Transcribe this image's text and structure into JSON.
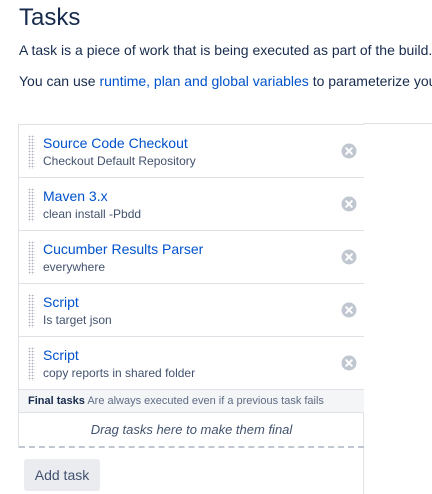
{
  "page": {
    "title": "Tasks",
    "description": "A task is a piece of work that is being executed as part of the build.",
    "variables_prefix": "You can use ",
    "variables_link": "runtime, plan and global variables",
    "variables_suffix": " to parameterize you"
  },
  "tasks": [
    {
      "title": "Source Code Checkout",
      "subtitle": "Checkout Default Repository"
    },
    {
      "title": "Maven 3.x",
      "subtitle": "clean install -Pbdd"
    },
    {
      "title": "Cucumber Results Parser",
      "subtitle": "everywhere"
    },
    {
      "title": "Script",
      "subtitle": "Is target json"
    },
    {
      "title": "Script",
      "subtitle": "copy reports in shared folder"
    }
  ],
  "final_tasks": {
    "label": "Final tasks",
    "note": "Are always executed even if a previous task fails",
    "drop_hint": "Drag tasks here to make them final"
  },
  "actions": {
    "add_task_label": "Add task"
  },
  "icons": {
    "remove": "remove-circle-icon",
    "drag": "drag-handle-icon"
  },
  "colors": {
    "link": "#0052cc",
    "text": "#172b4d",
    "remove_icon": "#c1c7d0",
    "final_header_bg": "#f4f5f7"
  }
}
